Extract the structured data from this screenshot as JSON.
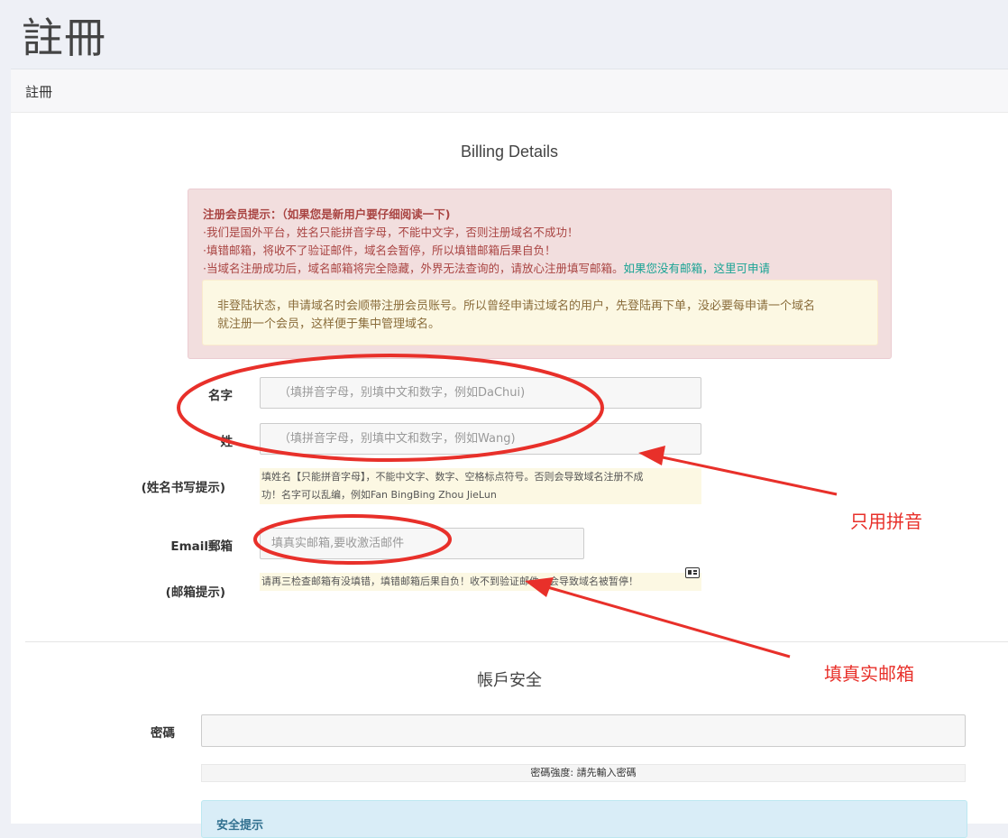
{
  "page": {
    "title": "註冊"
  },
  "panel": {
    "heading": "註冊"
  },
  "billing": {
    "title": "Billing Details",
    "notice": {
      "heading": "注册会员提示：（如果您是新用户要仔细阅读一下)",
      "line1": "·我们是国外平台，姓名只能拼音字母，不能中文字，否则注册域名不成功！",
      "line2": "·填错邮箱，将收不了验证邮件，域名会暂停，所以填错邮箱后果自负！",
      "line3": "·当域名注册成功后，域名邮箱将完全隐藏，外界无法查询的，请放心注册填写邮箱。",
      "line3_link": "如果您没有邮箱，这里可申请",
      "warning_line1": "非登陆状态，申请域名时会顺带注册会员账号。所以曾经申请过域名的用户，先登陆再下单，没必要每申请一个域名",
      "warning_line2": "就注册一个会员，这样便于集中管理域名。"
    },
    "first_name": {
      "label": "名字",
      "placeholder": "（填拼音字母，别填中文和数字，例如DaChui)"
    },
    "last_name": {
      "label": "姓",
      "placeholder": "（填拼音字母，别填中文和数字，例如Wang)"
    },
    "name_hint": {
      "label": "(姓名书写提示)",
      "line1": "填姓名【只能拼音字母】，不能中文字、数字、空格标点符号。否则会导致域名注册不成",
      "line2": "功！名字可以乱编，例如Fan BingBing Zhou JieLun"
    },
    "email": {
      "label": "Email郵箱",
      "placeholder": "填真实邮箱,要收激活邮件"
    },
    "email_hint": {
      "label": "(邮箱提示)",
      "text": "请再三检查邮箱有没填错，填错邮箱后果自负！收不到验证邮件，会导致域名被暂停！",
      "icon": "contact-card-icon"
    }
  },
  "security": {
    "title": "帳戶安全",
    "password_label": "密碼",
    "password_value": "",
    "strength_text": "密碼強度: 請先輸入密碼",
    "tip_heading": "安全提示"
  },
  "annotations": {
    "pinyin_note": "只用拼音",
    "email_note": "填真实邮箱",
    "color": "#e8302a"
  }
}
